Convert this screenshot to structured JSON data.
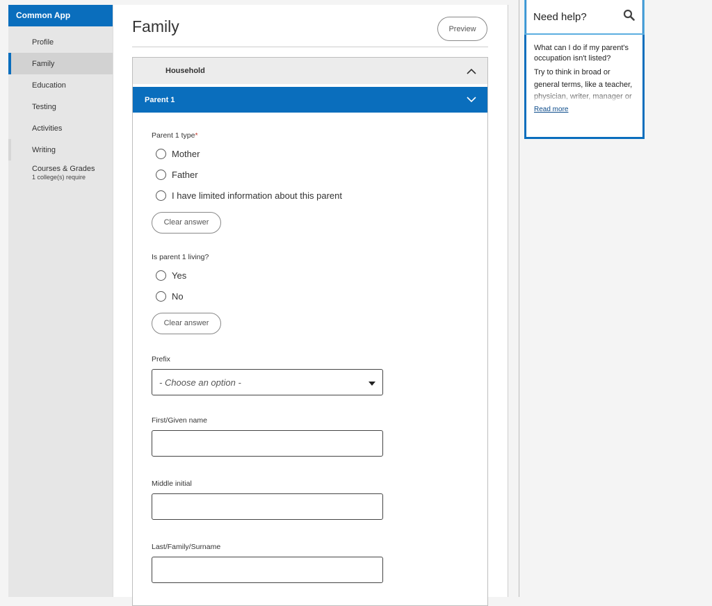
{
  "brand": "Common App",
  "nav": [
    {
      "label": "Profile"
    },
    {
      "label": "Family",
      "active": true
    },
    {
      "label": "Education"
    },
    {
      "label": "Testing"
    },
    {
      "label": "Activities"
    },
    {
      "label": "Writing"
    },
    {
      "label": "Courses & Grades",
      "sub": "1 college(s) require"
    }
  ],
  "page": {
    "title": "Family",
    "preview_label": "Preview"
  },
  "sections": {
    "household": "Household",
    "parent1": "Parent 1"
  },
  "parent_type": {
    "label": "Parent 1 type",
    "required_mark": "*",
    "options": [
      "Mother",
      "Father",
      "I have limited information about this parent"
    ],
    "clear_label": "Clear answer"
  },
  "living": {
    "label": "Is parent 1 living?",
    "options": [
      "Yes",
      "No"
    ],
    "clear_label": "Clear answer"
  },
  "prefix": {
    "label": "Prefix",
    "value": "- Choose an option -"
  },
  "first_name": {
    "label": "First/Given name",
    "value": ""
  },
  "middle_initial": {
    "label": "Middle initial",
    "value": ""
  },
  "last_name": {
    "label": "Last/Family/Surname",
    "value": ""
  },
  "help": {
    "title": "Need help?",
    "question": "What can I do if my parent's occupation isn't listed?",
    "answer": "Try to think in broad or general terms, like a teacher, physician, writer, manager or retail. If you are",
    "read_more": "Read more"
  },
  "colors": {
    "accent": "#0a6ebd",
    "help_border_light": "#5aaee0"
  }
}
